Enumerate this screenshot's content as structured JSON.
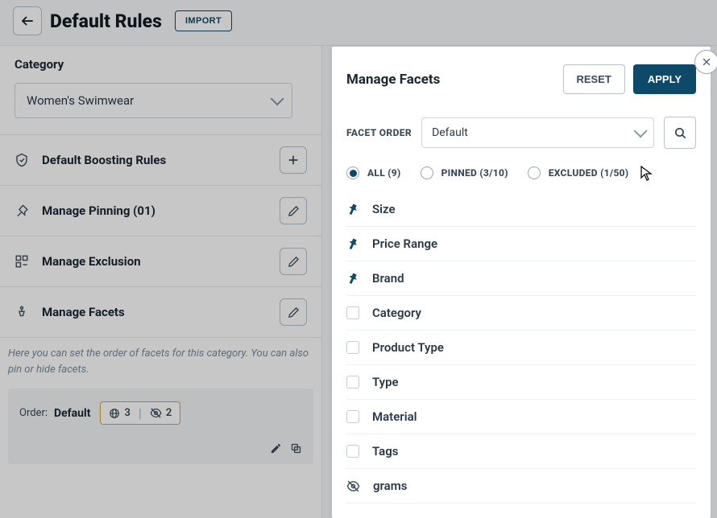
{
  "header": {
    "title": "Default Rules",
    "import_label": "IMPORT"
  },
  "left": {
    "category_label": "Category",
    "category_value": "Women's Swimwear",
    "rows": {
      "boosting": "Default Boosting Rules",
      "pinning": "Manage Pinning (01)",
      "exclusion": "Manage Exclusion",
      "facets": "Manage Facets"
    },
    "desc": "Here you can set the order of facets for this category. You can also pin or hide facets.",
    "order": {
      "label": "Order:",
      "value": "Default",
      "pinned_count": "3",
      "hidden_count": "2"
    }
  },
  "panel": {
    "title": "Manage Facets",
    "reset": "RESET",
    "apply": "APPLY",
    "facet_order_label": "FACET ORDER",
    "facet_order_value": "Default",
    "filters": {
      "all": "ALL (9)",
      "pinned": "PINNED (3/10)",
      "excluded": "EXCLUDED (1/50)"
    },
    "facets": [
      {
        "label": "Size",
        "state": "pinned"
      },
      {
        "label": "Price Range",
        "state": "pinned"
      },
      {
        "label": "Brand",
        "state": "pinned"
      },
      {
        "label": "Category",
        "state": "none"
      },
      {
        "label": "Product Type",
        "state": "none"
      },
      {
        "label": "Type",
        "state": "none"
      },
      {
        "label": "Material",
        "state": "none"
      },
      {
        "label": "Tags",
        "state": "none"
      },
      {
        "label": "grams",
        "state": "hidden"
      }
    ]
  }
}
